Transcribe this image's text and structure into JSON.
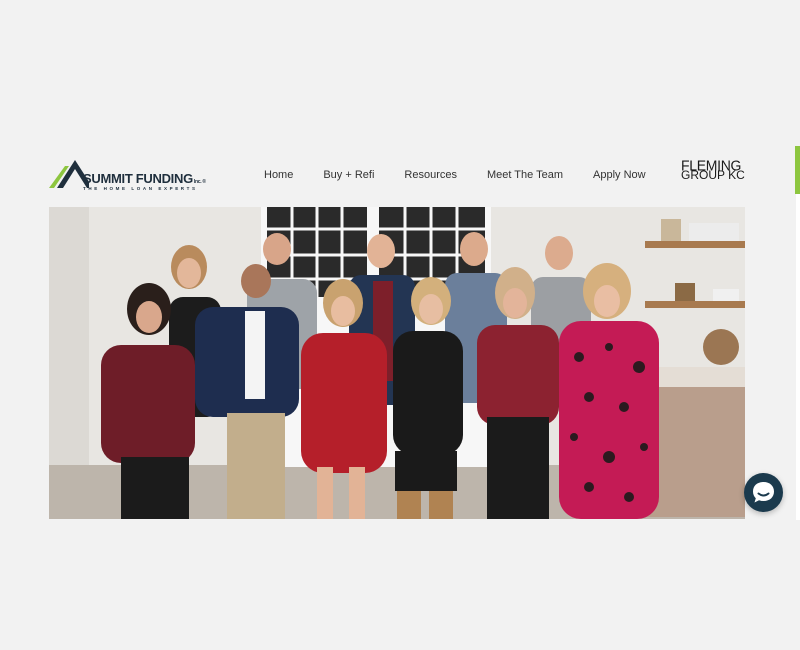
{
  "brand": {
    "name": "SUMMIT FUNDING",
    "suffix": "Inc.",
    "registered_mark": "®",
    "tagline": "THE HOME LOAN EXPERTS",
    "logo_icon": "roof-chevron-icon",
    "colors": {
      "green": "#8dc63f",
      "navy": "#1f2f3d"
    }
  },
  "nav": {
    "items": [
      {
        "label": "Home"
      },
      {
        "label": "Buy + Refi"
      },
      {
        "label": "Resources"
      },
      {
        "label": "Meet The Team"
      },
      {
        "label": "Apply Now"
      }
    ]
  },
  "partner": {
    "line1": "FLEMING",
    "line2": "GROUP KC"
  },
  "hero": {
    "image_icon": "team-photo"
  },
  "chat": {
    "icon": "chat-bubble-icon",
    "color": "#1b3a4d"
  },
  "accent_color": "#8dc63f"
}
